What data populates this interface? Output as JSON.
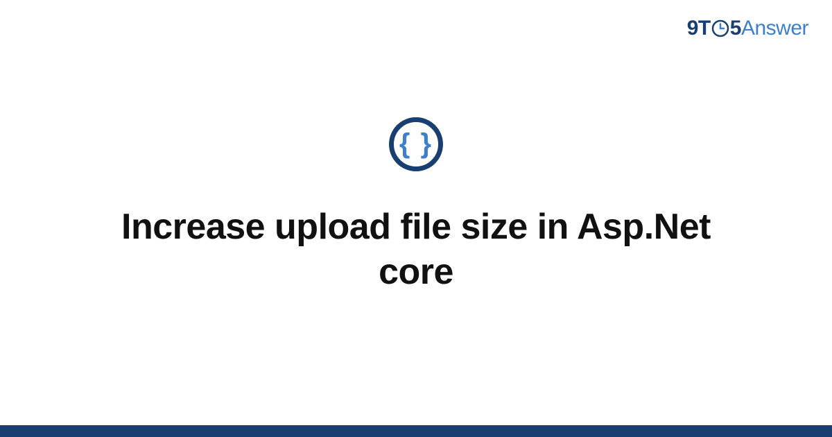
{
  "logo": {
    "part1": "9T",
    "part2": "5",
    "part3": "Answer"
  },
  "category_icon": {
    "name": "code-braces-icon",
    "glyph": "{ }"
  },
  "title": "Increase upload file size in Asp.Net core",
  "colors": {
    "primary_dark": "#183f70",
    "primary_light": "#3e7fc9"
  }
}
